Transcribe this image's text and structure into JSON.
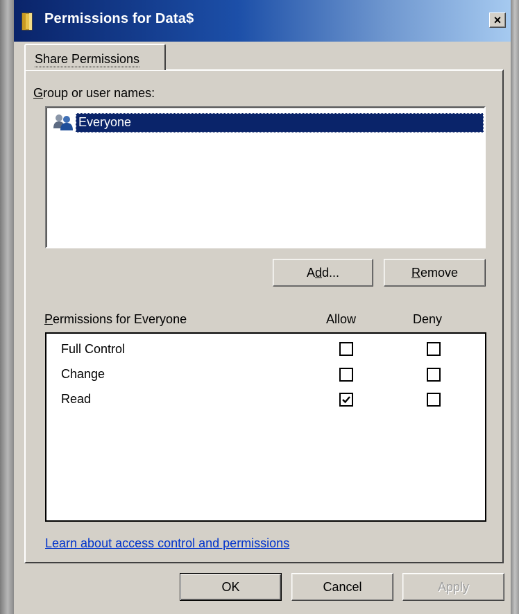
{
  "window": {
    "title": "Permissions for Data$",
    "icon": "folder-icon",
    "close_label": "×"
  },
  "tabs": [
    {
      "label": "Share Permissions",
      "selected": true
    }
  ],
  "group_section": {
    "label": "Group or user names:",
    "users": [
      {
        "name": "Everyone",
        "icon": "users-icon",
        "selected": true
      }
    ]
  },
  "buttons": {
    "add": {
      "pre": "A",
      "accel": "d",
      "post": "d..."
    },
    "remove": {
      "pre": "",
      "accel": "R",
      "post": "emove"
    }
  },
  "permissions": {
    "header": "Permissions for Everyone",
    "allow_header": "Allow",
    "deny_header": "Deny",
    "rows": [
      {
        "name": "Full Control",
        "allow": false,
        "deny": false
      },
      {
        "name": "Change",
        "allow": false,
        "deny": false
      },
      {
        "name": "Read",
        "allow": true,
        "deny": false
      }
    ]
  },
  "link": "Learn about access control and permissions",
  "footer": {
    "ok": "OK",
    "cancel": "Cancel",
    "apply": "Apply",
    "apply_enabled": false
  },
  "colors": {
    "titlebar_start": "#0a246a",
    "titlebar_end": "#a6caf0",
    "selection": "#0a246a",
    "dialog_face": "#d4d0c8",
    "link": "#0033cc"
  }
}
